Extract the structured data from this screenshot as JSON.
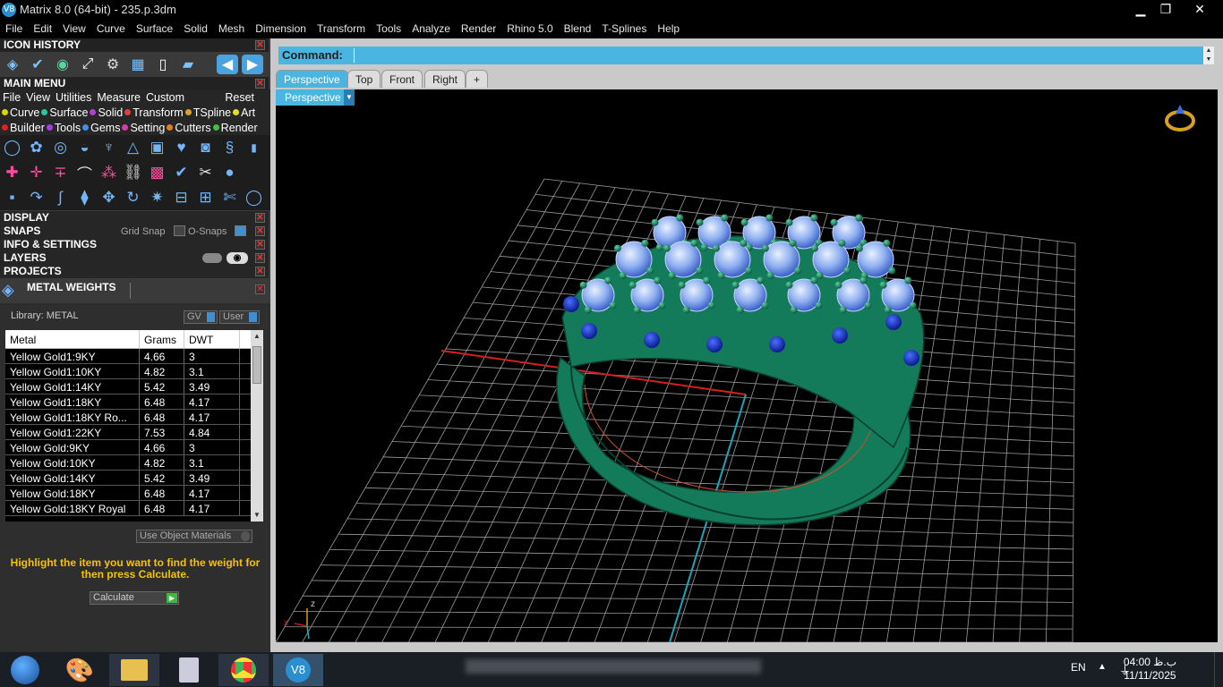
{
  "window": {
    "title": "Matrix 8.0 (64-bit) - 235.p.3dm",
    "icon": "matrix-app-icon"
  },
  "menubar": [
    "File",
    "Edit",
    "View",
    "Curve",
    "Surface",
    "Solid",
    "Mesh",
    "Dimension",
    "Transform",
    "Tools",
    "Analyze",
    "Render",
    "Rhino 5.0",
    "Blend",
    "T-Splines",
    "Help"
  ],
  "left_panel": {
    "icon_history": {
      "title": "ICON HISTORY"
    },
    "main_menu": {
      "title": "MAIN MENU",
      "row1": [
        "File",
        "View",
        "Utilities",
        "Measure",
        "Custom"
      ],
      "reset": "Reset",
      "row2": [
        {
          "label": "Curve",
          "color": "#d8d800"
        },
        {
          "label": "Surface",
          "color": "#28c8a0"
        },
        {
          "label": "Solid",
          "color": "#b040d0"
        },
        {
          "label": "Transform",
          "color": "#e04040"
        },
        {
          "label": "TSpline",
          "color": "#e0a020"
        },
        {
          "label": "Art",
          "color": "#e0e020"
        }
      ],
      "row3": [
        {
          "label": "Builder",
          "color": "#e02020"
        },
        {
          "label": "Tools",
          "color": "#a040e0"
        },
        {
          "label": "Gems",
          "color": "#4090e0"
        },
        {
          "label": "Setting",
          "color": "#d040b0"
        },
        {
          "label": "Cutters",
          "color": "#e08020"
        },
        {
          "label": "Render",
          "color": "#40c040"
        }
      ]
    },
    "display": {
      "title": "DISPLAY"
    },
    "snaps": {
      "title": "SNAPS",
      "grid_snap": "Grid Snap",
      "o_snaps": "O-Snaps"
    },
    "info": {
      "title": "INFO & SETTINGS"
    },
    "layers": {
      "title": "LAYERS"
    },
    "projects": {
      "title": "PROJECTS"
    },
    "metal_weights": {
      "title": "METAL WEIGHTS",
      "library": "Library: METAL",
      "gv": "GV",
      "user": "User",
      "columns": [
        "Metal",
        "Grams",
        "DWT"
      ],
      "rows": [
        [
          "Yellow Gold1:9KY",
          "4.66",
          "3"
        ],
        [
          "Yellow Gold1:10KY",
          "4.82",
          "3.1"
        ],
        [
          "Yellow Gold1:14KY",
          "5.42",
          "3.49"
        ],
        [
          "Yellow Gold1:18KY",
          "6.48",
          "4.17"
        ],
        [
          "Yellow Gold1:18KY Ro...",
          "6.48",
          "4.17"
        ],
        [
          "Yellow Gold1:22KY",
          "7.53",
          "4.84"
        ],
        [
          "Yellow Gold:9KY",
          "4.66",
          "3"
        ],
        [
          "Yellow Gold:10KY",
          "4.82",
          "3.1"
        ],
        [
          "Yellow Gold:14KY",
          "5.42",
          "3.49"
        ],
        [
          "Yellow Gold:18KY",
          "6.48",
          "4.17"
        ],
        [
          "Yellow Gold:18KY Royal",
          "6.48",
          "4.17"
        ]
      ],
      "use_object_materials": "Use Object Materials",
      "hint": "Highlight the item you want to find the weight for then press Calculate.",
      "calculate": "Calculate"
    }
  },
  "command": {
    "label": "Command:"
  },
  "tabs": [
    "Perspective",
    "Top",
    "Front",
    "Right",
    "+"
  ],
  "viewport_label": "Perspective",
  "axis": {
    "z": "z",
    "x": "x",
    "y": "y"
  },
  "taskbar": {
    "lang": "EN",
    "time": "04:00 ب.ظ",
    "date": "11/11/2025"
  }
}
